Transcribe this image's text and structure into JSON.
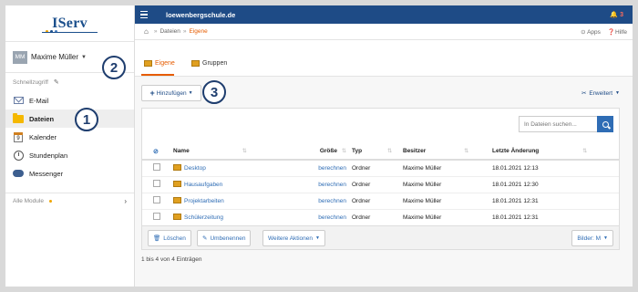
{
  "app": {
    "logo": "IServ",
    "domain": "loewenbergschule.de",
    "notification_count": "3"
  },
  "user": {
    "initials": "MM",
    "name": "Maxime Müller"
  },
  "sidebar": {
    "quick_access_label": "Schnellzugriff",
    "items": [
      {
        "label": "E-Mail",
        "icon": "mail-icon"
      },
      {
        "label": "Dateien",
        "icon": "folder-icon",
        "active": true
      },
      {
        "label": "Kalender",
        "icon": "calendar-icon",
        "day": "9"
      },
      {
        "label": "Stundenplan",
        "icon": "clock-icon"
      },
      {
        "label": "Messenger",
        "icon": "messenger-icon"
      }
    ],
    "modules_label": "Alle Module"
  },
  "breadcrumb": {
    "items": [
      "Dateien",
      "Eigene"
    ],
    "apps_label": "Apps",
    "help_label": "Hilfe"
  },
  "tabs": [
    {
      "label": "Eigene",
      "active": true
    },
    {
      "label": "Gruppen",
      "active": false
    }
  ],
  "toolbar": {
    "add_label": "Hinzufügen",
    "extended_label": "Erweitert",
    "search_placeholder": "In Dateien suchen..."
  },
  "table": {
    "columns": [
      "Name",
      "Größe",
      "Typ",
      "Besitzer",
      "Letzte Änderung"
    ],
    "rows": [
      {
        "name": "Desktop",
        "size": "berechnen",
        "type": "Ordner",
        "owner": "Maxime Müller",
        "modified": "18.01.2021 12:13"
      },
      {
        "name": "Hausaufgaben",
        "size": "berechnen",
        "type": "Ordner",
        "owner": "Maxime Müller",
        "modified": "18.01.2021 12:30"
      },
      {
        "name": "Projektarbeiten",
        "size": "berechnen",
        "type": "Ordner",
        "owner": "Maxime Müller",
        "modified": "18.01.2021 12:31"
      },
      {
        "name": "Schülerzeitung",
        "size": "berechnen",
        "type": "Ordner",
        "owner": "Maxime Müller",
        "modified": "18.01.2021 12:31"
      }
    ]
  },
  "actions": {
    "delete_label": "Löschen",
    "rename_label": "Umbenennen",
    "more_label": "Weitere Aktionen",
    "images_label": "Bilder: M"
  },
  "footer": {
    "count_text": "1 bis 4 von 4 Einträgen"
  },
  "markers": [
    "1",
    "2",
    "3"
  ],
  "colors": {
    "topbar": "#1e4b86",
    "accent": "#e65c00",
    "link": "#2f6db5"
  }
}
